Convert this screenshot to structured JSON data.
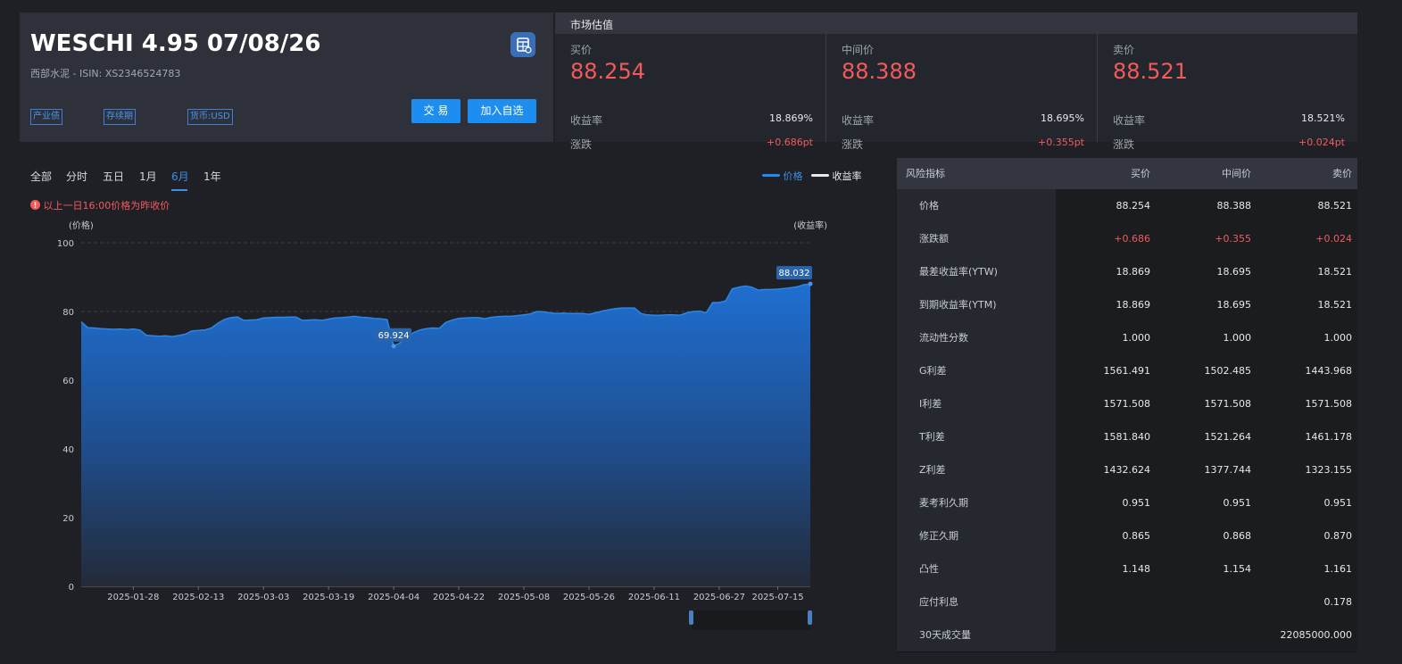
{
  "bond": {
    "title": "WESCHI 4.95 07/08/26",
    "subtitle": "西部水泥 - ISIN: XS2346524783",
    "tags": [
      "产业债",
      "存续期",
      "货币:USD"
    ],
    "trade_label": "交 易",
    "watch_label": "加入自选",
    "calc_icon": "calculator-icon"
  },
  "market": {
    "title": "市场估值",
    "columns": [
      {
        "label": "买价",
        "price": "88.254",
        "yield_label": "收益率",
        "yield": "18.869%",
        "change_label": "涨跌",
        "change": "+0.686pt"
      },
      {
        "label": "中间价",
        "price": "88.388",
        "yield_label": "收益率",
        "yield": "18.695%",
        "change_label": "涨跌",
        "change": "+0.355pt"
      },
      {
        "label": "卖价",
        "price": "88.521",
        "yield_label": "收益率",
        "yield": "18.521%",
        "change_label": "涨跌",
        "change": "+0.024pt"
      }
    ]
  },
  "tabs": [
    "全部",
    "分时",
    "五日",
    "1月",
    "6月",
    "1年"
  ],
  "active_tab": "6月",
  "note": "以上一日16:00价格为昨收价",
  "legend": {
    "price": "价格",
    "yield": "收益率"
  },
  "colors": {
    "accent": "#1e8df0",
    "up": "#f25b5b",
    "panel": "#2e313a",
    "background": "#1f2025"
  },
  "chart_data": {
    "type": "area",
    "ylabel_left": "(价格)",
    "ylabel_right": "(收益率)",
    "ylim": [
      0,
      100
    ],
    "yticks": [
      0,
      20,
      40,
      60,
      80,
      100
    ],
    "x_tick_labels": [
      "2025-01-28",
      "2025-02-13",
      "2025-03-03",
      "2025-03-19",
      "2025-04-04",
      "2025-04-22",
      "2025-05-08",
      "2025-05-26",
      "2025-06-11",
      "2025-06-27",
      "2025-07-15"
    ],
    "x_tick_index": [
      8,
      18,
      28,
      38,
      48,
      58,
      68,
      78,
      88,
      98,
      107
    ],
    "series": [
      {
        "name": "价格",
        "values": [
          77.0,
          75.3,
          75.2,
          75.0,
          74.9,
          74.8,
          74.9,
          74.7,
          74.9,
          74.6,
          73.1,
          72.9,
          72.8,
          72.9,
          72.7,
          73.0,
          73.4,
          74.3,
          74.5,
          74.6,
          75.2,
          76.6,
          77.7,
          78.2,
          78.4,
          77.4,
          77.5,
          77.6,
          78.1,
          78.2,
          78.3,
          78.3,
          78.4,
          78.4,
          77.4,
          77.5,
          77.6,
          77.4,
          77.8,
          78.1,
          78.2,
          78.4,
          78.6,
          78.3,
          78.2,
          78.0,
          77.9,
          77.6,
          69.9,
          70.9,
          72.6,
          73.8,
          74.6,
          75.0,
          75.2,
          75.1,
          76.8,
          77.5,
          78.0,
          78.1,
          78.2,
          78.2,
          77.9,
          78.3,
          78.5,
          78.6,
          78.6,
          78.8,
          79.0,
          79.3,
          80.0,
          79.9,
          79.6,
          79.4,
          79.5,
          79.4,
          79.4,
          79.4,
          79.2,
          79.6,
          80.1,
          80.5,
          80.8,
          81.0,
          81.0,
          81.0,
          79.4,
          79.0,
          78.9,
          78.9,
          79.0,
          79.0,
          78.9,
          79.6,
          80.0,
          80.1,
          79.6,
          82.6,
          82.6,
          83.1,
          86.6,
          87.1,
          87.4,
          87.1,
          86.2,
          86.4,
          86.4,
          86.5,
          86.7,
          86.9,
          87.2,
          87.8,
          88.032
        ]
      }
    ],
    "annotations": [
      {
        "label": "69.924",
        "index": 48,
        "value": 69.924
      },
      {
        "label": "88.032",
        "index": 112,
        "value": 88.032
      }
    ]
  },
  "risk": {
    "headers": [
      "风险指标",
      "买价",
      "中间价",
      "卖价"
    ],
    "rows": [
      {
        "name": "价格",
        "bid": "88.254",
        "mid": "88.388",
        "ask": "88.521"
      },
      {
        "name": "涨跌额",
        "bid": "+0.686",
        "mid": "+0.355",
        "ask": "+0.024"
      },
      {
        "name": "最差收益率(YTW)",
        "bid": "18.869",
        "mid": "18.695",
        "ask": "18.521"
      },
      {
        "name": "到期收益率(YTM)",
        "bid": "18.869",
        "mid": "18.695",
        "ask": "18.521"
      },
      {
        "name": "流动性分数",
        "bid": "1.000",
        "mid": "1.000",
        "ask": "1.000"
      },
      {
        "name": "G利差",
        "bid": "1561.491",
        "mid": "1502.485",
        "ask": "1443.968"
      },
      {
        "name": "I利差",
        "bid": "1571.508",
        "mid": "1571.508",
        "ask": "1571.508"
      },
      {
        "name": "T利差",
        "bid": "1581.840",
        "mid": "1521.264",
        "ask": "1461.178"
      },
      {
        "name": "Z利差",
        "bid": "1432.624",
        "mid": "1377.744",
        "ask": "1323.155"
      },
      {
        "name": "麦考利久期",
        "bid": "0.951",
        "mid": "0.951",
        "ask": "0.951"
      },
      {
        "name": "修正久期",
        "bid": "0.865",
        "mid": "0.868",
        "ask": "0.870"
      },
      {
        "name": "凸性",
        "bid": "1.148",
        "mid": "1.154",
        "ask": "1.161"
      },
      {
        "name": "应付利息",
        "bid": "",
        "mid": "",
        "ask": "0.178"
      },
      {
        "name": "30天成交量",
        "bid": "",
        "mid": "",
        "ask": "22085000.000"
      }
    ]
  }
}
